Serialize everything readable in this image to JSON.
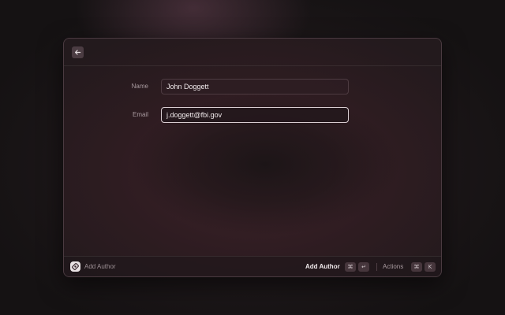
{
  "form": {
    "name": {
      "label": "Name",
      "value": "John Doggett"
    },
    "email": {
      "label": "Email",
      "value": "j.doggett@fbi.gov"
    }
  },
  "footer": {
    "title": "Add Author",
    "primary_action": "Add Author",
    "primary_shortcut": [
      "⌘",
      "↵"
    ],
    "actions_label": "Actions",
    "actions_shortcut": [
      "⌘",
      "K"
    ]
  },
  "icons": {
    "back": "arrow-left-icon",
    "app": "extension-app-icon"
  },
  "colors": {
    "accent_focus_border": "#d9cdd1",
    "text_primary": "#f1eaec",
    "text_secondary": "#a99ba0"
  }
}
